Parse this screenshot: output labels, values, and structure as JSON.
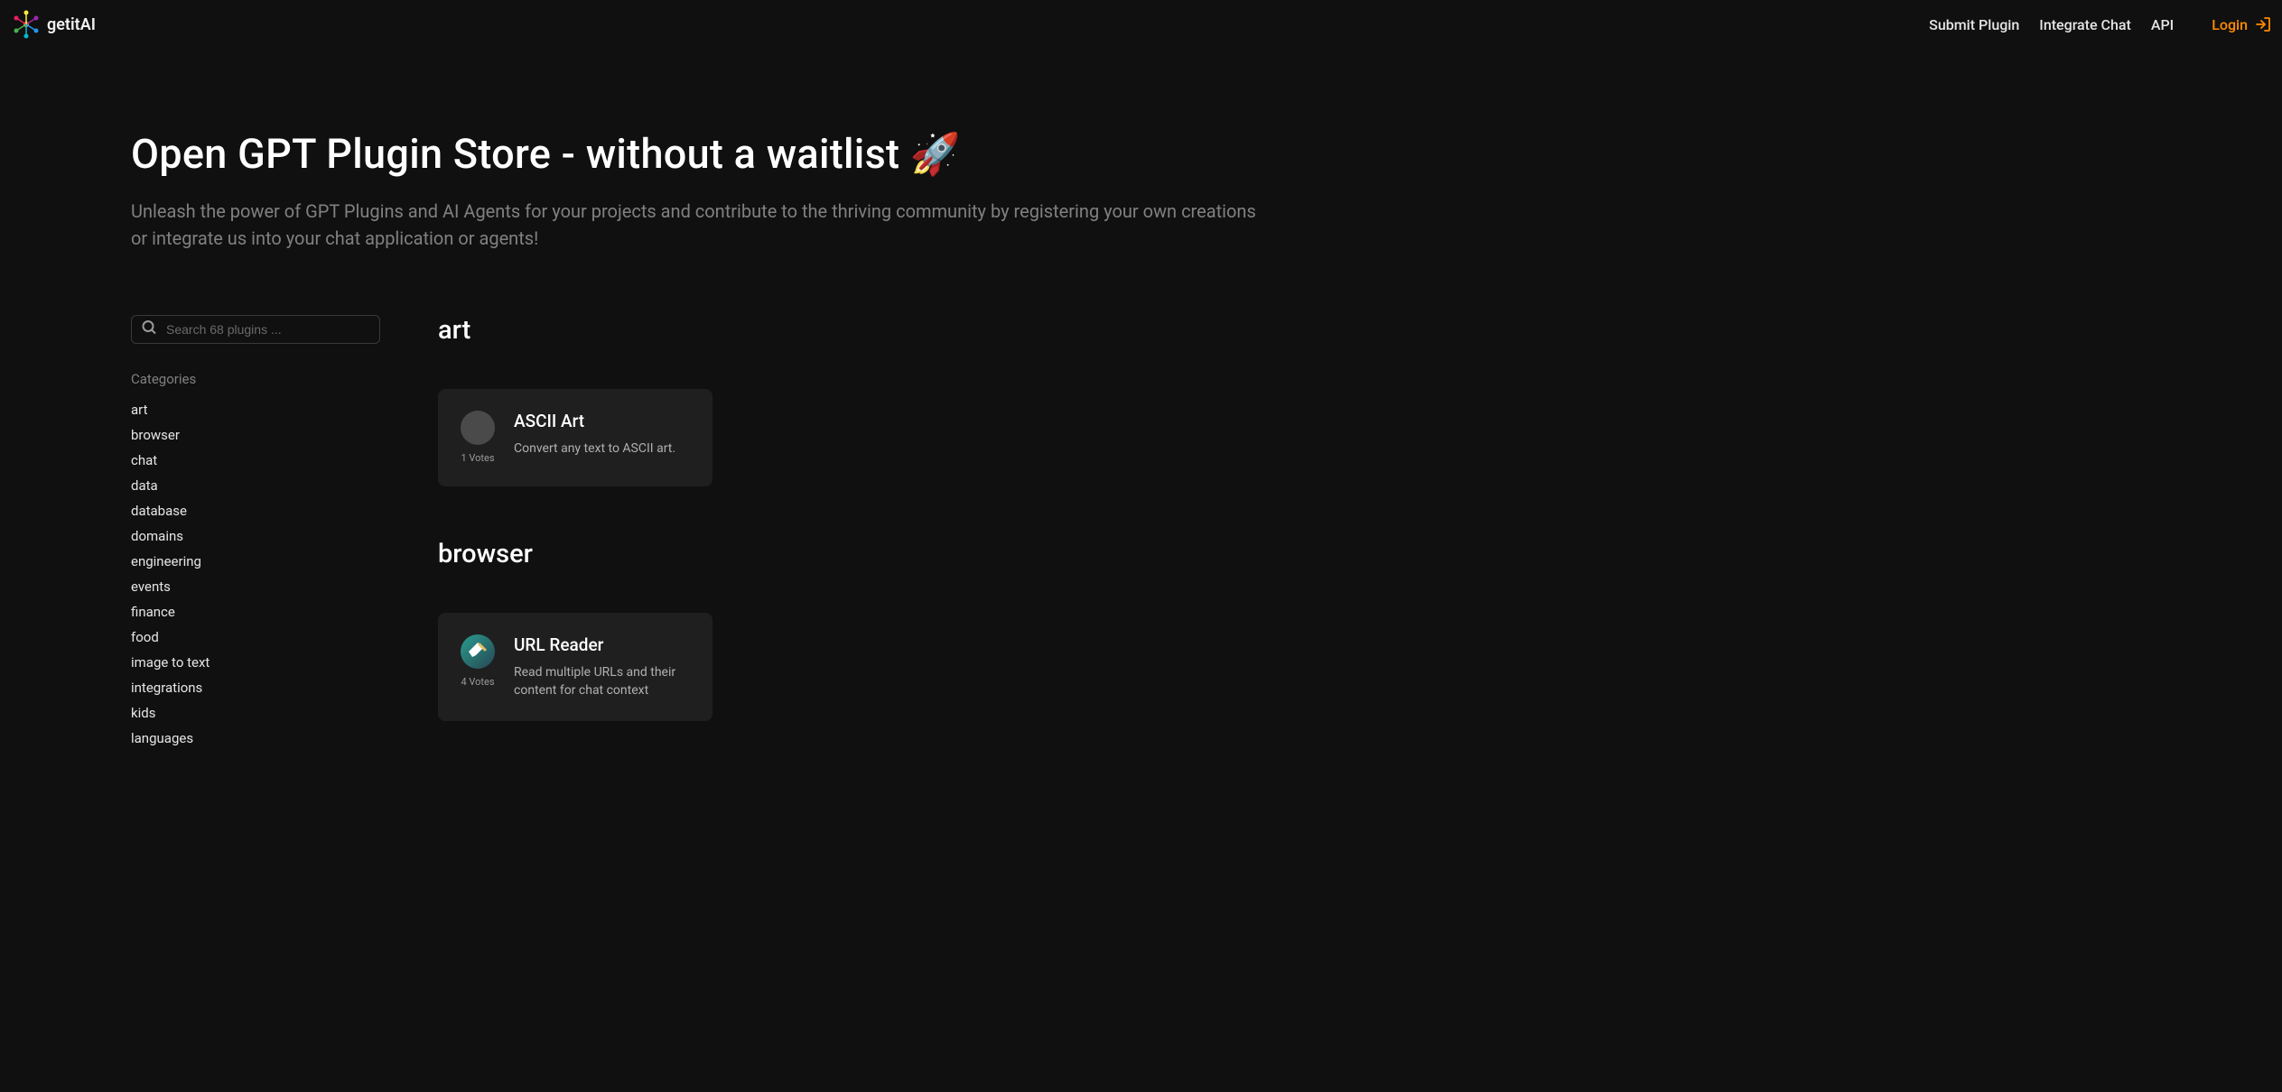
{
  "header": {
    "logo_text": "getitAI",
    "nav": {
      "submit_plugin": "Submit Plugin",
      "integrate_chat": "Integrate Chat",
      "api": "API",
      "login": "Login"
    }
  },
  "hero": {
    "title": "Open GPT Plugin Store - without a waitlist 🚀",
    "subtitle": "Unleash the power of GPT Plugins and AI Agents for your projects and contribute to the thriving community by registering your own creations or integrate us into your chat application or agents!"
  },
  "search": {
    "placeholder": "Search 68 plugins ..."
  },
  "sidebar": {
    "categories_label": "Categories",
    "categories": [
      "art",
      "browser",
      "chat",
      "data",
      "database",
      "domains",
      "engineering",
      "events",
      "finance",
      "food",
      "image to text",
      "integrations",
      "kids",
      "languages"
    ]
  },
  "sections": [
    {
      "title": "art",
      "plugins": [
        {
          "name": "ASCII Art",
          "description": "Convert any text to ASCII art.",
          "votes": "1 Votes",
          "avatar_type": "blank"
        }
      ]
    },
    {
      "title": "browser",
      "plugins": [
        {
          "name": "URL Reader",
          "description": "Read multiple URLs and their content for chat context",
          "votes": "4 Votes",
          "avatar_type": "url"
        }
      ]
    }
  ]
}
